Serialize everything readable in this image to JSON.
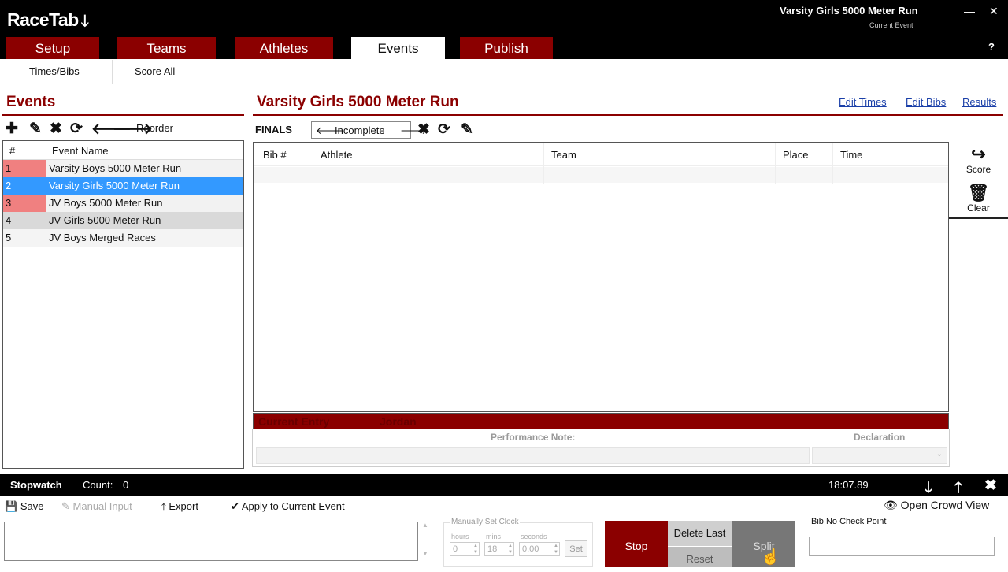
{
  "app": {
    "logo": "RaceTab",
    "logo_arrow": "🡓",
    "current_event_name": "Varsity Girls 5000 Meter Run",
    "current_event_caption": "Current Event",
    "help": "?"
  },
  "window": {
    "minimize": "—",
    "close": "✕"
  },
  "tabs": [
    {
      "label": "Setup",
      "active": false
    },
    {
      "label": "Teams",
      "active": false
    },
    {
      "label": "Athletes",
      "active": false
    },
    {
      "label": "Events",
      "active": true
    },
    {
      "label": "Publish",
      "active": false
    }
  ],
  "subnav": [
    {
      "label": "Times/Bibs"
    },
    {
      "label": "Score All"
    }
  ],
  "events_panel": {
    "title": "Events",
    "reorder_label": "Reorder",
    "columns": [
      "#",
      "Event Name"
    ],
    "rows": [
      {
        "num": "1",
        "name": "Varsity Boys 5000 Meter Run",
        "status_color": "#f08080",
        "selected": false
      },
      {
        "num": "2",
        "name": "Varsity Girls 5000 Meter Run",
        "status_color": "#3399ff",
        "selected": true
      },
      {
        "num": "3",
        "name": "JV Boys 5000 Meter Run",
        "status_color": "#f08080",
        "selected": false
      },
      {
        "num": "4",
        "name": "JV Girls 5000 Meter Run",
        "status_color": "#d9d9d9",
        "selected": false
      },
      {
        "num": "5",
        "name": "JV Boys Merged Races",
        "status_color": "#f2f2f2",
        "selected": false
      }
    ]
  },
  "main": {
    "title": "Varsity Girls 5000 Meter Run",
    "links": {
      "edit_times": "Edit Times",
      "edit_bibs": "Edit Bibs",
      "results": "Results"
    },
    "round_label": "FINALS",
    "status": {
      "prev": "🡐",
      "value": "Incomplete",
      "next": "🡒"
    },
    "columns": [
      "Bib #",
      "Athlete",
      "Team",
      "Place",
      "Time"
    ],
    "side": {
      "score": "Score",
      "clear": "Clear"
    },
    "current_entry_label": "Current Entry",
    "current_entry_value": "Jordan",
    "performance_note": "Performance Note:",
    "declaration": "Declaration",
    "declaration_arrow": "⌄"
  },
  "stopwatch": {
    "title": "Stopwatch",
    "count_label": "Count:",
    "count_value": "0",
    "time": "18:07.89",
    "toolbar": {
      "save": "Save",
      "manual_input": "Manual Input",
      "export": "Export",
      "apply": "Apply to Current Event"
    },
    "open_crowd_view": "Open Crowd View",
    "clock": {
      "caption": "Manually Set Clock",
      "hours_label": "hours",
      "hours_value": "0",
      "mins_label": "mins",
      "mins_value": "18",
      "seconds_label": "seconds",
      "seconds_value": "0.00",
      "set": "Set"
    },
    "buttons": {
      "stop": "Stop",
      "delete_last": "Delete Last",
      "reset": "Reset",
      "split": "Split"
    },
    "bib_checkpoint_label": "Bib No Check Point"
  }
}
